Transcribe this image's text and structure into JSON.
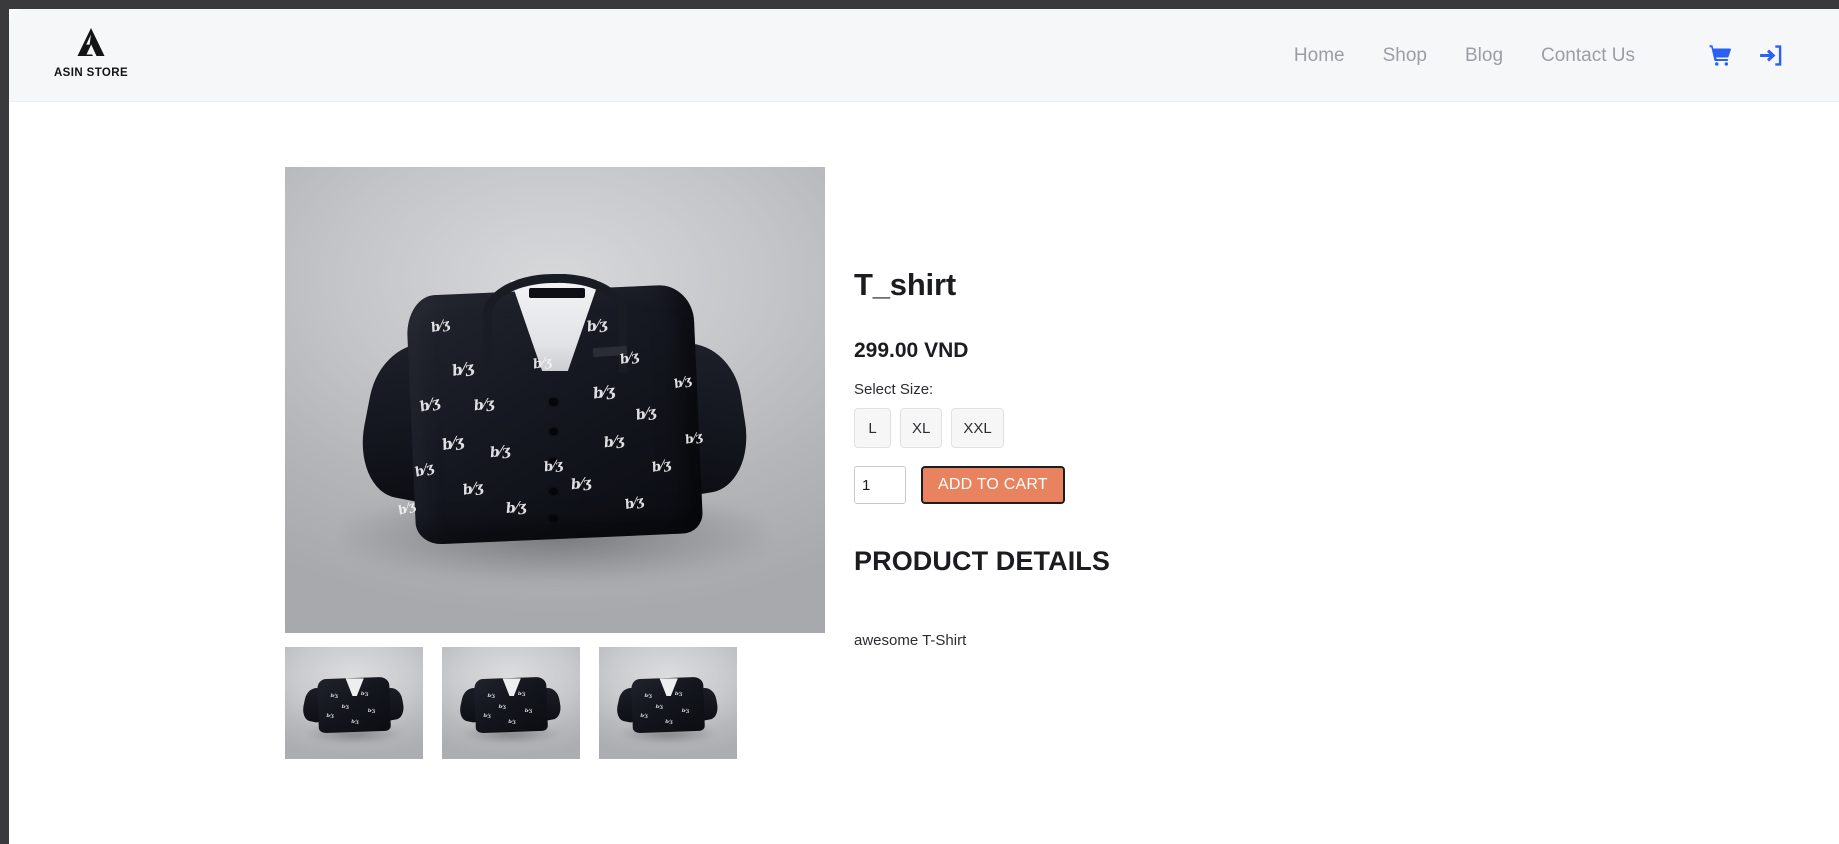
{
  "brand": {
    "wordmark": "ASIN STORE",
    "logo_icon": "triangle-a-monogram-icon"
  },
  "nav": {
    "items": [
      {
        "label": "Home"
      },
      {
        "label": "Shop"
      },
      {
        "label": "Blog"
      },
      {
        "label": "Contact Us"
      }
    ]
  },
  "header_actions": {
    "cart_icon": "shopping-cart-icon",
    "login_icon": "sign-in-icon"
  },
  "product": {
    "title": "T_shirt",
    "price": "299.00 VND",
    "size_label": "Select Size:",
    "sizes": [
      {
        "label": "L"
      },
      {
        "label": "XL"
      },
      {
        "label": "XXL"
      }
    ],
    "quantity_value": "1",
    "quantity_placeholder": "1",
    "add_to_cart_label": "ADD TO CART",
    "details_heading": "PRODUCT DETAILS",
    "details_body": "awesome T-Shirt",
    "main_image_alt": "black cardigan with white script print",
    "thumbnails": [
      {
        "alt": "black cardigan thumbnail 1"
      },
      {
        "alt": "black cardigan thumbnail 2"
      },
      {
        "alt": "black cardigan thumbnail 3"
      }
    ]
  },
  "colors": {
    "accent": "#e8825f",
    "icon_blue": "#2a61f5",
    "header_bg": "#f6f7f9",
    "nav_text": "#9a9ea6",
    "text_dark": "#1b1c1f"
  }
}
